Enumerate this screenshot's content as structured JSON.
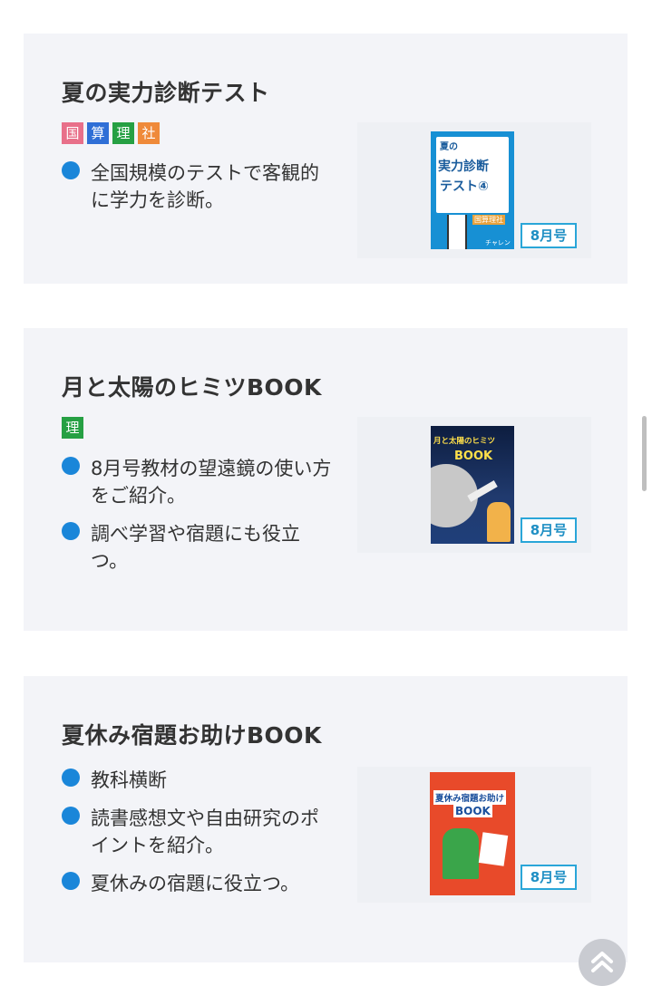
{
  "cards": [
    {
      "title": "夏の実力診断テスト",
      "tags": [
        {
          "label": "国",
          "color": "#e8708a"
        },
        {
          "label": "算",
          "color": "#2f6fd6"
        },
        {
          "label": "理",
          "color": "#26a043"
        },
        {
          "label": "社",
          "color": "#ef8a3a"
        }
      ],
      "bullets": [
        "全国規模のテストで客観的に学力を診断。"
      ],
      "cover": {
        "lines": [
          "夏の",
          "実力診断",
          "テスト④"
        ],
        "sub": "国算理社",
        "brand": "チャレンジ"
      },
      "badge": "8月号"
    },
    {
      "title": "月と太陽のヒミツBOOK",
      "tags": [
        {
          "label": "理",
          "color": "#26a043"
        }
      ],
      "bullets": [
        "8月号教材の望遠鏡の使い方をご紹介。",
        "調べ学習や宿題にも役立つ。"
      ],
      "cover": {
        "lines": [
          "月と太陽のヒミツ",
          "BOOK"
        ]
      },
      "badge": "8月号"
    },
    {
      "title": "夏休み宿題お助けBOOK",
      "tags": [],
      "bullets": [
        "教科横断",
        "読書感想文や自由研究のポイントを紹介。",
        "夏休みの宿題に役立つ。"
      ],
      "cover": {
        "lines": [
          "夏休み宿題お助け",
          "BOOK"
        ]
      },
      "badge": "8月号"
    }
  ],
  "colors": {
    "accent": "#1a86d9",
    "badge_border": "#2aa6d8",
    "card_bg": "#f3f4f8"
  },
  "icons": {
    "scroll_top": "double-chevron-up-icon"
  }
}
